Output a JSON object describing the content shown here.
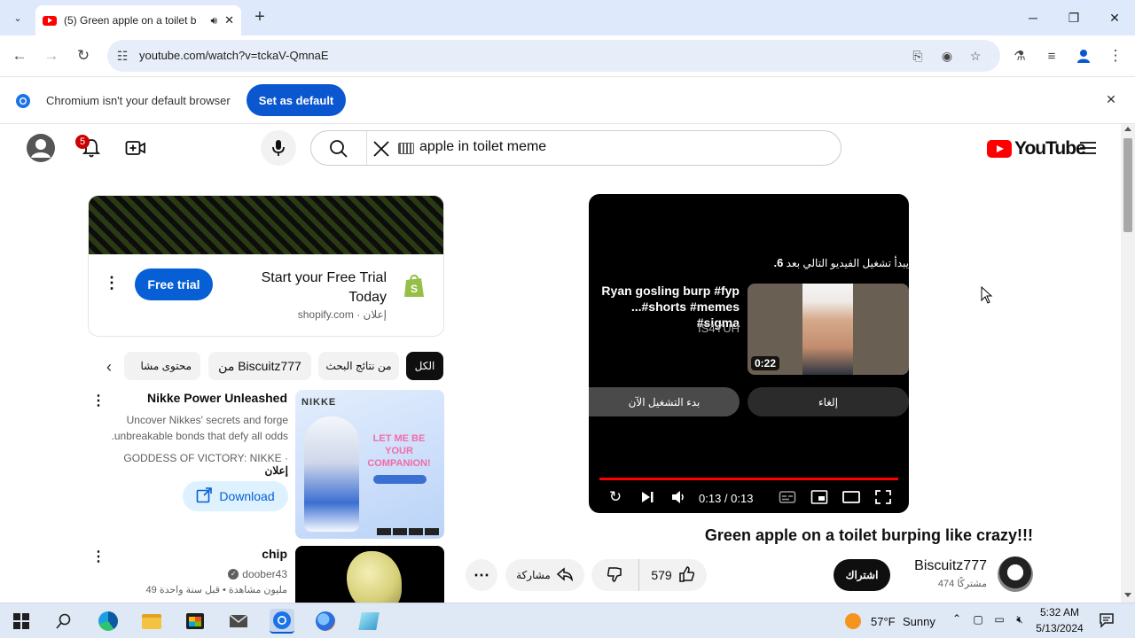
{
  "browser": {
    "tab_title": "(5) Green apple on a toilet b",
    "new_tab_icon": "+",
    "url": "youtube.com/watch?v=tckaV-QmnaE",
    "infobar_message": "Chromium isn't your default browser",
    "set_default_label": "Set as default"
  },
  "yt_header": {
    "notification_count": "5",
    "search_value": "apple in toilet meme",
    "logo_text": "YouTube",
    "accent_color": "#ff0000"
  },
  "ad": {
    "cta_label": "Free trial",
    "title_line1": "Start your Free Trial",
    "title_line2": "Today",
    "domain": "shopify.com",
    "ad_tag": "إعلان"
  },
  "chips": [
    "الكل",
    "من نتائج البحث",
    "من Biscuitz777",
    "محتوى مشا"
  ],
  "videos": [
    {
      "title": "Nikke Power Unleashed",
      "desc_line1": "Uncover Nikkes' secrets and forge",
      "desc_line2": ".unbreakable bonds that defy all odds",
      "channel": "GODDESS OF VICTORY: NIKKE",
      "ad_tag": "إعلان",
      "cta_label": "Download",
      "thumb_logo": "NIKKE",
      "thumb_text": "LET ME BE YOUR COMPANION!"
    },
    {
      "title": "chip",
      "channel": "doober43",
      "meta": "49 مليون مشاهدة • قبل سنة واحدة"
    }
  ],
  "player": {
    "up_next_text": "يبدأ تشغيل الفيديو التالي بعد",
    "countdown": "6.",
    "next_title_line1": "Ryan gosling burp #fyp",
    "next_title_line2": "...#shorts #memes #sigma",
    "next_channel": "IS4YUH",
    "next_duration": "0:22",
    "play_now_label": "بدء التشغيل الآن",
    "cancel_label": "إلغاء",
    "time": "0:13 / 0:13",
    "progress": 1.0
  },
  "video_info": {
    "title": "Green apple on a toilet burping like crazy!!!",
    "channel_name": "Biscuitz777",
    "subscribers": "474 مشتركًا",
    "subscribe_label": "اشتراك",
    "like_count": "579",
    "share_label": "مشاركة"
  },
  "taskbar": {
    "weather_temp": "57°F",
    "weather_desc": "Sunny",
    "time": "5:32 AM",
    "date": "5/13/2024"
  }
}
